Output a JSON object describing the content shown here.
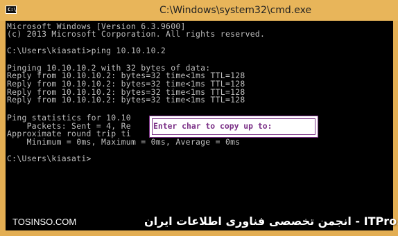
{
  "window": {
    "title": "C:\\Windows\\system32\\cmd.exe",
    "icon_label": "C:\\"
  },
  "console": {
    "lines": [
      "Microsoft Windows [Version 6.3.9600]",
      "(c) 2013 Microsoft Corporation. All rights reserved.",
      "",
      "C:\\Users\\kiasati>ping 10.10.10.2",
      "",
      "Pinging 10.10.10.2 with 32 bytes of data:",
      "Reply from 10.10.10.2: bytes=32 time<1ms TTL=128",
      "Reply from 10.10.10.2: bytes=32 time<1ms TTL=128",
      "Reply from 10.10.10.2: bytes=32 time<1ms TTL=128",
      "Reply from 10.10.10.2: bytes=32 time<1ms TTL=128",
      "",
      "Ping statistics for 10.10",
      "    Packets: Sent = 4, Re                               ,",
      "Approximate round trip ti",
      "    Minimum = 0ms, Maximum = 0ms, Average = 0ms",
      "",
      "C:\\Users\\kiasati>"
    ]
  },
  "popup": {
    "prompt": "Enter char to copy up to: "
  },
  "watermark": {
    "left": "TOSINSO.COM",
    "right": "ITPro.ir - انجمن تخصصی فناوری اطلاعات ایران"
  },
  "colors": {
    "frame": "#e3ae53",
    "console_bg": "#000000",
    "console_fg": "#c0c0c0",
    "popup_accent": "#7a2f86"
  }
}
